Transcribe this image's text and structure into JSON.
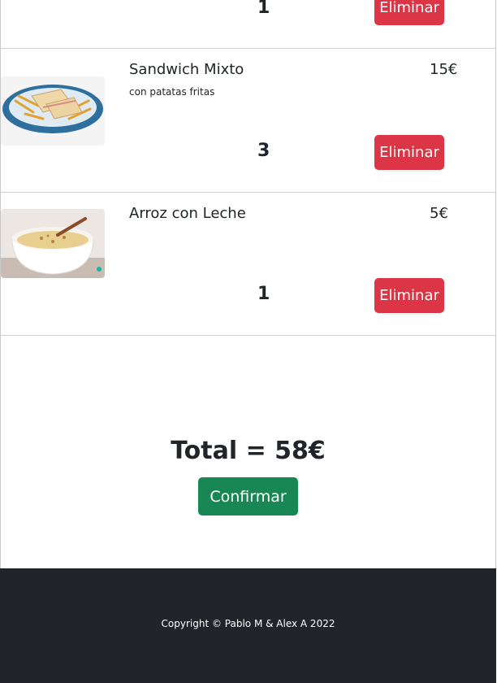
{
  "cart": {
    "items": [
      {
        "name": "",
        "description": "",
        "price": "",
        "quantity": "1",
        "remove_label": "Eliminar"
      },
      {
        "name": "Sandwich Mixto",
        "description": "con patatas fritas",
        "price": "15€",
        "quantity": "3",
        "remove_label": "Eliminar",
        "image": "sandwich-with-fries-photo"
      },
      {
        "name": "Arroz con Leche",
        "description": "",
        "price": "5€",
        "quantity": "1",
        "remove_label": "Eliminar",
        "image": "rice-pudding-photo"
      }
    ],
    "total_label": "Total = 58€",
    "confirm_label": "Confirmar"
  },
  "footer": {
    "copyright": "Copyright © Pablo M & Alex A 2022"
  },
  "colors": {
    "danger": "#dc3545",
    "success": "#198754",
    "footer_bg": "#212529",
    "text": "#212529"
  }
}
